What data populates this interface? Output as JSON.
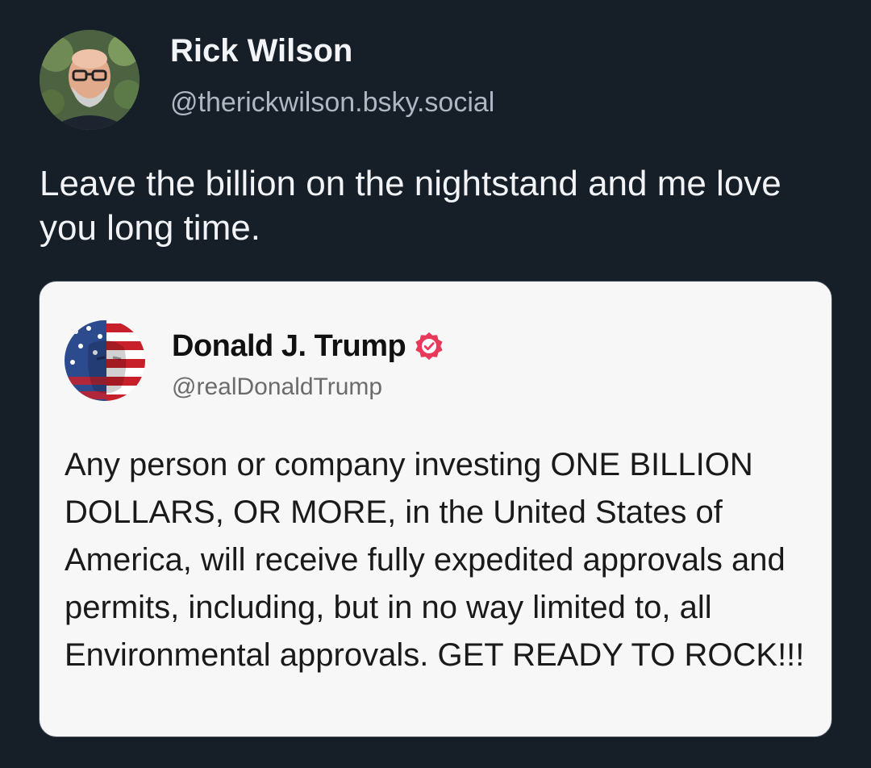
{
  "post": {
    "author": {
      "name": "Rick Wilson",
      "handle": "@therickwilson.bsky.social"
    },
    "text": "Leave the billion on the nightstand and me love you long time."
  },
  "embed": {
    "author": {
      "name": "Donald J. Trump",
      "handle": "@realDonaldTrump",
      "verified": true,
      "verified_icon": "verified-badge-icon"
    },
    "text": "Any person or company investing ONE BILLION DOLLARS, OR MORE, in the United States of America, will receive fully expedited approvals and permits, including, but in no way limited to, all Environmental approvals. GET READY TO ROCK!!!"
  },
  "colors": {
    "background": "#161e27",
    "badge": "#e8395a"
  }
}
